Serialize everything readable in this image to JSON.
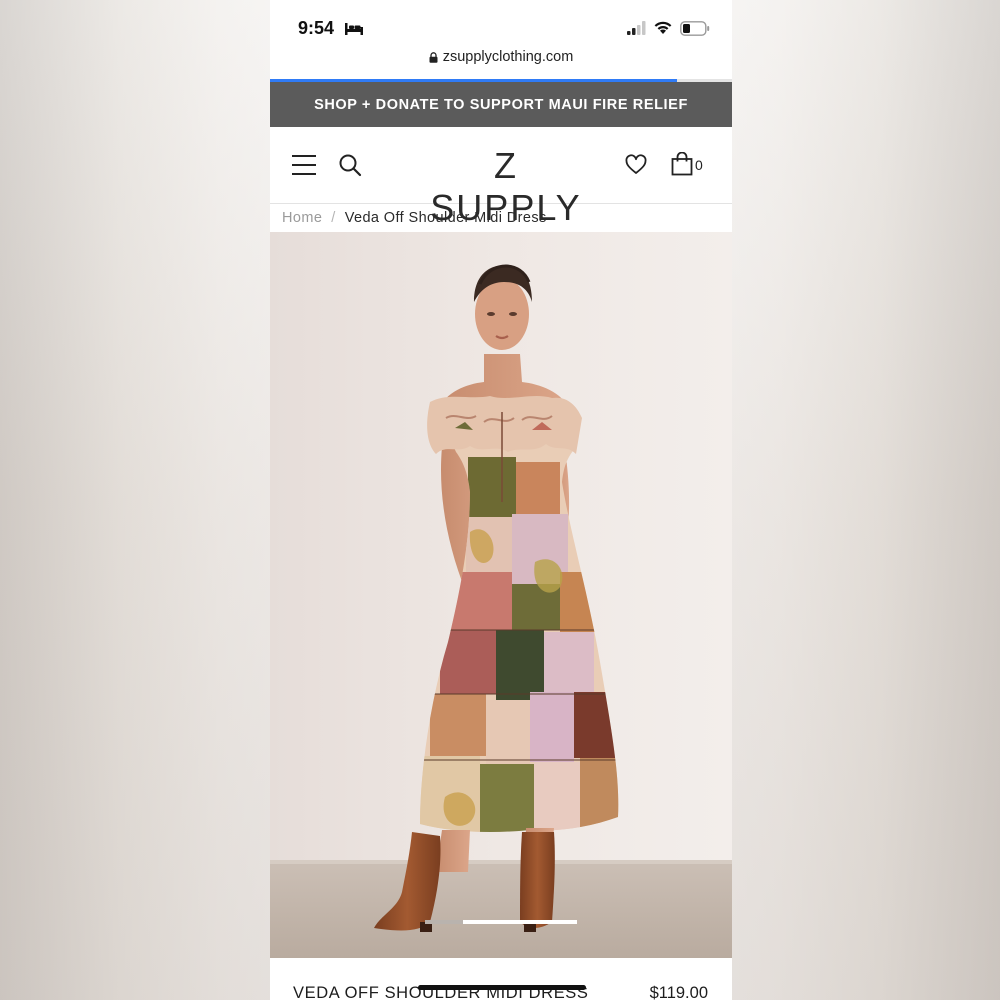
{
  "status_bar": {
    "time": "9:54",
    "icons": [
      "bed-icon",
      "cellular-signal-icon",
      "wifi-icon",
      "battery-icon"
    ]
  },
  "browser": {
    "url": "zsupplyclothing.com",
    "load_progress": 0.88
  },
  "promo_banner": {
    "text": "SHOP + DONATE TO SUPPORT MAUI FIRE RELIEF",
    "background": "#5b5b5b"
  },
  "header": {
    "logo": "Z SUPPLY",
    "cart_count": "0",
    "icons": [
      "menu-icon",
      "search-icon",
      "heart-icon",
      "shopping-bag-icon"
    ]
  },
  "breadcrumb": {
    "home": "Home",
    "separator": "/",
    "current": "Veda Off Shoulder Midi Dress"
  },
  "gallery": {
    "image_alt": "Model wearing patchwork print off shoulder midi dress with brown boots",
    "active_image_fraction": 0.75
  },
  "product": {
    "title": "VEDA OFF SHOULDER MIDI DRESS",
    "price": "$119.00"
  },
  "colors": {
    "accent_progress": "#2f7bf6",
    "banner": "#5b5b5b"
  }
}
